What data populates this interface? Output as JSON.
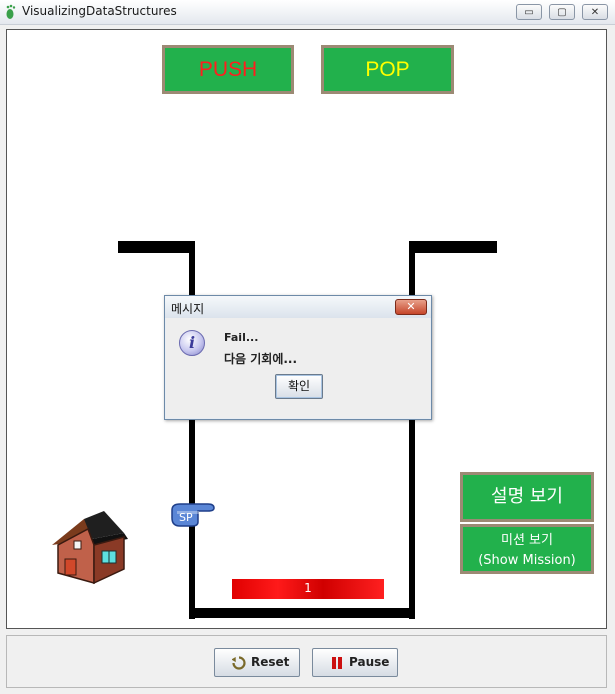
{
  "window": {
    "title": "VisualizingDataStructures",
    "controls": {
      "minimize": "▭",
      "maximize": "▢",
      "close": "✕"
    }
  },
  "game": {
    "push_label": "PUSH",
    "pop_label": "POP",
    "explain_label": "설명 보기",
    "mission_label_ko": "미션 보기",
    "mission_label_en": "(Show Mission)",
    "stack_item_value": "1",
    "hand_label": "SP",
    "colors": {
      "button_green": "#22b14c",
      "push_text": "#ff1e1e",
      "pop_text": "#ffff00",
      "stack_item": "#e00000"
    }
  },
  "dialog": {
    "title": "메시지",
    "icon": "info-icon",
    "message_line1": "Fail...",
    "message_line2": "다음 기회에...",
    "ok_label": "확인"
  },
  "toolbar": {
    "reset_label": "Reset",
    "pause_label": "Pause",
    "reset_icon": "refresh-icon",
    "pause_icon": "pause-icon"
  }
}
